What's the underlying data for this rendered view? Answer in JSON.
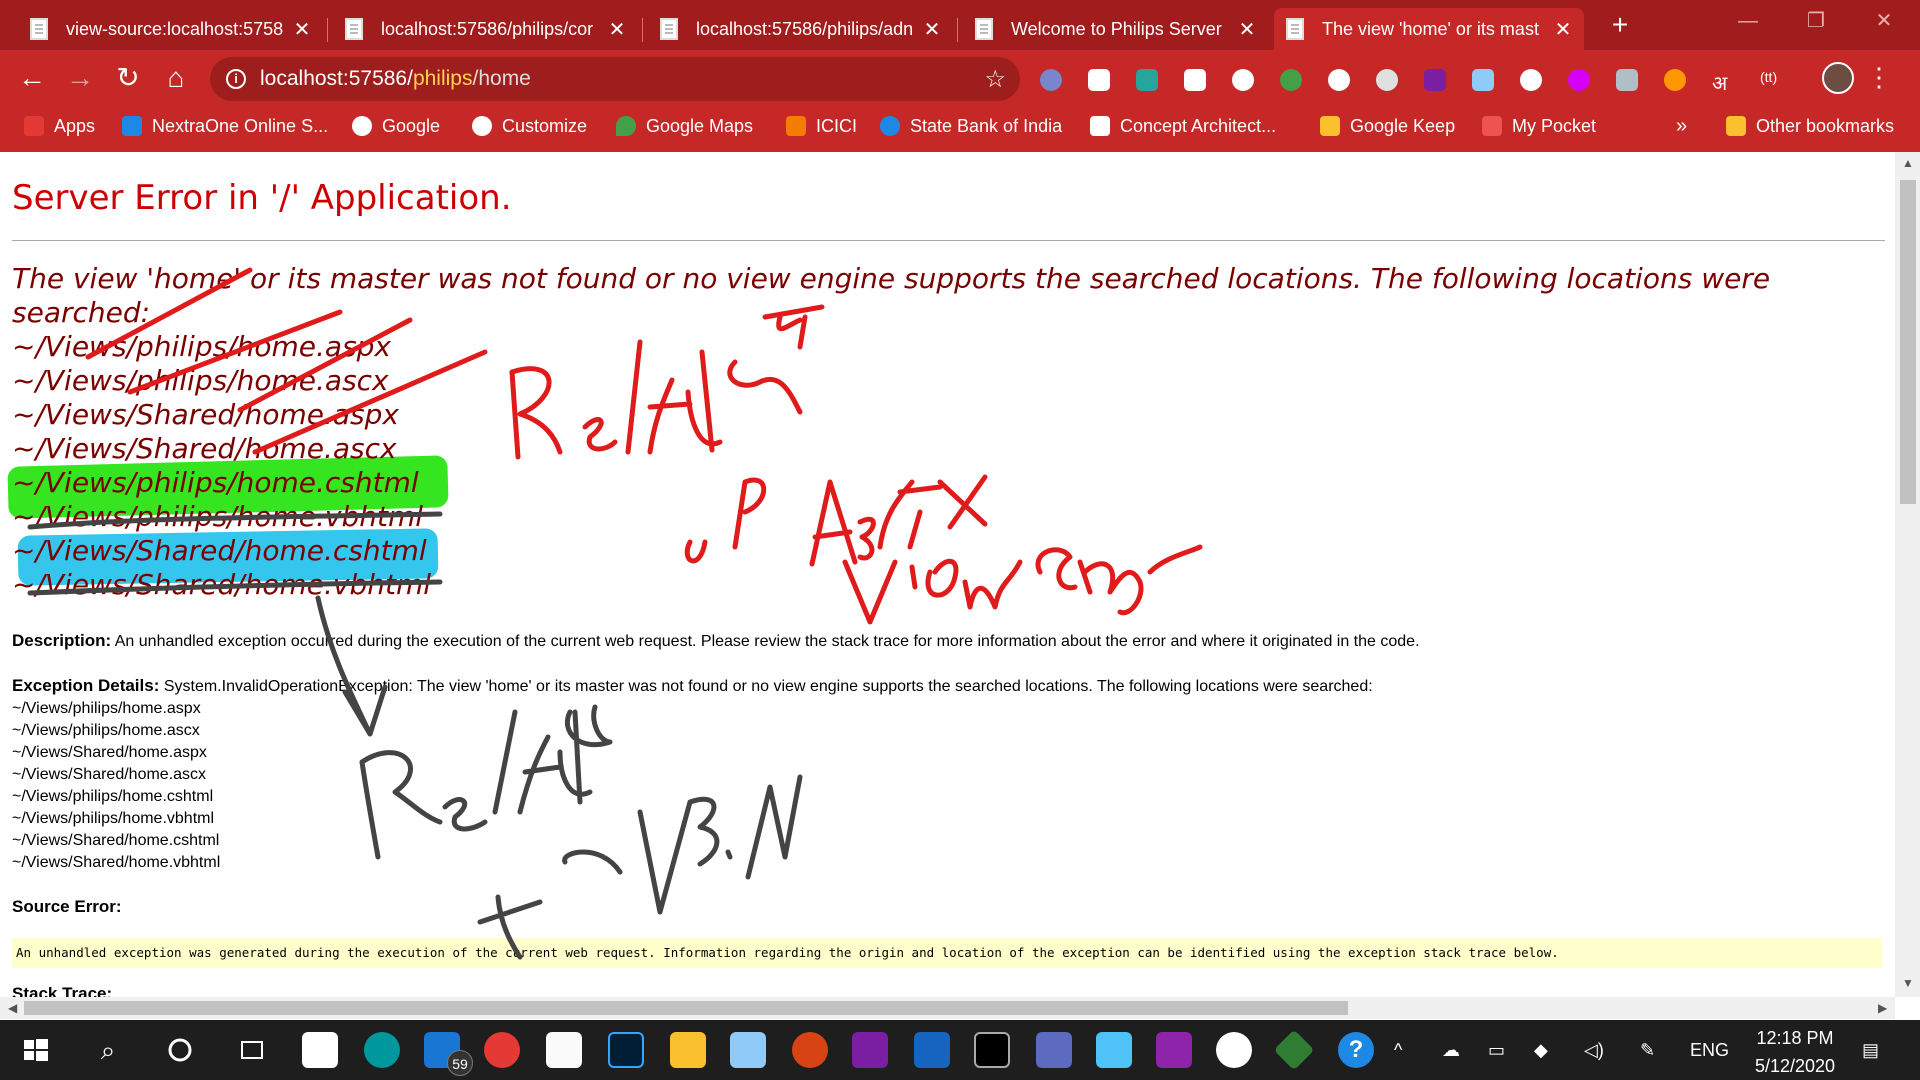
{
  "browser": {
    "tabs": [
      {
        "title": "view-source:localhost:5758"
      },
      {
        "title": "localhost:57586/philips/cor"
      },
      {
        "title": "localhost:57586/philips/adn"
      },
      {
        "title": "Welcome to Philips Server"
      },
      {
        "title": "The view 'home' or its mast"
      }
    ],
    "new_tab": "+",
    "address": {
      "host": "localhost:57586/",
      "path1": "philips",
      "path2": "/home"
    },
    "bookmarks": [
      {
        "label": "Apps",
        "color": "#e53935"
      },
      {
        "label": "NextraOne Online S...",
        "color": "#1e88e5"
      },
      {
        "label": "Google",
        "color": "#ffffff"
      },
      {
        "label": "Customize",
        "color": "#ffffff"
      },
      {
        "label": "Google Maps",
        "color": "#43a047"
      },
      {
        "label": "ICICI",
        "color": "#f57c00"
      },
      {
        "label": "State Bank of India",
        "color": "#1e88e5"
      },
      {
        "label": "Concept Architect...",
        "color": "#ffffff"
      },
      {
        "label": "Google Keep",
        "color": "#fbc02d"
      },
      {
        "label": "My Pocket",
        "color": "#ef5350"
      }
    ],
    "more": "»",
    "other_bookmarks": "Other bookmarks"
  },
  "page": {
    "title": "Server Error in '/' Application.",
    "message": "The view 'home' or its master was not found or no view engine supports the searched locations. The following locations were searched:",
    "locations": [
      "~/Views/philips/home.aspx",
      "~/Views/philips/home.ascx",
      "~/Views/Shared/home.aspx",
      "~/Views/Shared/home.ascx",
      "~/Views/philips/home.cshtml",
      "~/Views/philips/home.vbhtml",
      "~/Views/Shared/home.cshtml",
      "~/Views/Shared/home.vbhtml"
    ],
    "description_label": "Description:",
    "description": "An unhandled exception occurred during the execution of the current web request. Please review the stack trace for more information about the error and where it originated in the code.",
    "exception_label": "Exception Details:",
    "exception": "System.InvalidOperationException: The view 'home' or its master was not found or no view engine supports the searched locations. The following locations were searched:",
    "source_error_label": "Source Error:",
    "source_error": "An unhandled exception was generated during the execution of the current web request. Information regarding the origin and location of the exception can be identified using the exception stack trace below.",
    "stack_trace_label": "Stack Trace:"
  },
  "taskbar": {
    "mail_badge": "59",
    "language": "ENG",
    "time": "12:18 PM",
    "date": "5/12/2020"
  },
  "colors": {
    "chrome_red": "#c62828",
    "tabstrip_red": "#a11d1d",
    "error_title": "#cc0000",
    "error_message": "#7a0000",
    "ink_red": "#e01b1b",
    "ink_gray": "#444444",
    "highlight_green": "#35e51f",
    "highlight_blue": "#35c6ee"
  }
}
